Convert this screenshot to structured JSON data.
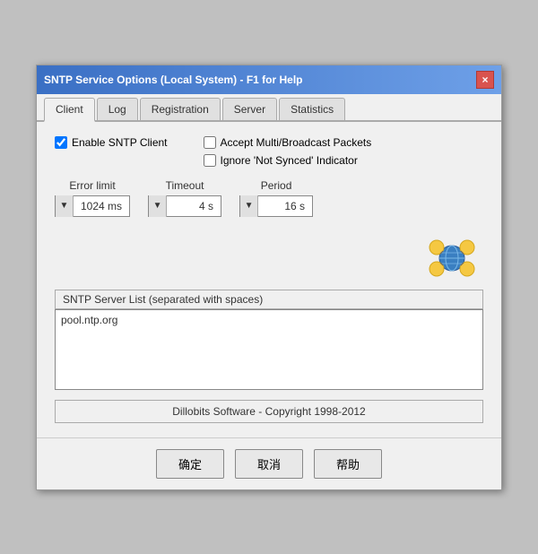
{
  "window": {
    "title": "SNTP Service Options (Local System) - F1 for Help",
    "close_button": "×"
  },
  "tabs": [
    {
      "label": "Client",
      "active": true
    },
    {
      "label": "Log",
      "active": false
    },
    {
      "label": "Registration",
      "active": false
    },
    {
      "label": "Server",
      "active": false
    },
    {
      "label": "Statistics",
      "active": false
    }
  ],
  "client_tab": {
    "enable_sntp_label": "Enable SNTP Client",
    "enable_sntp_checked": true,
    "accept_multi_label": "Accept Multi/Broadcast Packets",
    "accept_multi_checked": false,
    "ignore_synced_label": "Ignore 'Not Synced' Indicator",
    "ignore_synced_checked": false,
    "error_limit": {
      "label": "Error limit",
      "value": "1024 ms"
    },
    "timeout": {
      "label": "Timeout",
      "value": "4 s"
    },
    "period": {
      "label": "Period",
      "value": "16 s"
    },
    "server_list_label": "SNTP Server List (separated with spaces)",
    "server_list_value": "pool.ntp.org",
    "copyright": "Dillobits Software - Copyright 1998-2012"
  },
  "buttons": {
    "ok": "确定",
    "cancel": "取消",
    "help": "帮助"
  }
}
